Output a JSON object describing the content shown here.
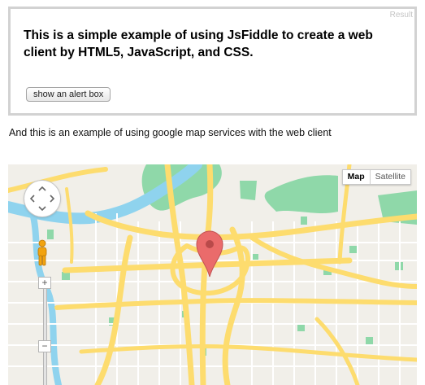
{
  "result_frame": {
    "label": "Result",
    "heading": "This is a simple example of using JsFiddle to create a web client by HTML5, JavaScript, and CSS.",
    "alert_button_label": "show an alert box"
  },
  "intro_text": "And this is an example of using google map services with the web client",
  "map": {
    "type_control": {
      "options": [
        "Map",
        "Satellite"
      ],
      "selected": "Map"
    },
    "zoom_in_label": "+",
    "zoom_out_label": "−",
    "colors": {
      "land": "#f1efe9",
      "road": "#fddc6e",
      "street": "#ffffff",
      "water": "#8fd3ee",
      "park": "#8fd8a9",
      "marker": "#ea6b6b"
    }
  }
}
